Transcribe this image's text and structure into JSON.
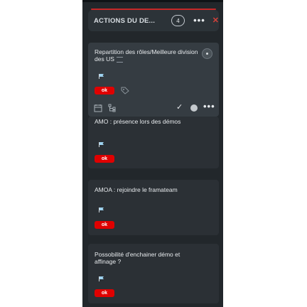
{
  "column": {
    "title": "ACTIONS DU DE...",
    "count": "4",
    "more_label": "•••",
    "close_label": "✕"
  },
  "cards": [
    {
      "title": "Repartition des rôles/Meilleure division des US",
      "badge": "ok"
    },
    {
      "title": "AMO : présence lors des démos",
      "badge": "ok"
    },
    {
      "title": "AMOA : rejoindre le framateam",
      "badge": "ok"
    },
    {
      "title": "Possobilité d'enchainer démo et affinage ?",
      "badge": "ok"
    }
  ],
  "card_toolbar": {
    "check_label": "✓",
    "more_label": "•••"
  },
  "icons": {
    "flag": "flag-icon",
    "tag": "tag-icon",
    "description": "description-icon",
    "calendar": "calendar-icon",
    "subtasks": "subtasks-icon",
    "avatar": "avatar-icon"
  },
  "colors": {
    "column_bg": "#22272b",
    "card_bg": "#2b3035",
    "badge": "#e00000",
    "close": "#d6413a",
    "accent_line": "#c62828"
  }
}
